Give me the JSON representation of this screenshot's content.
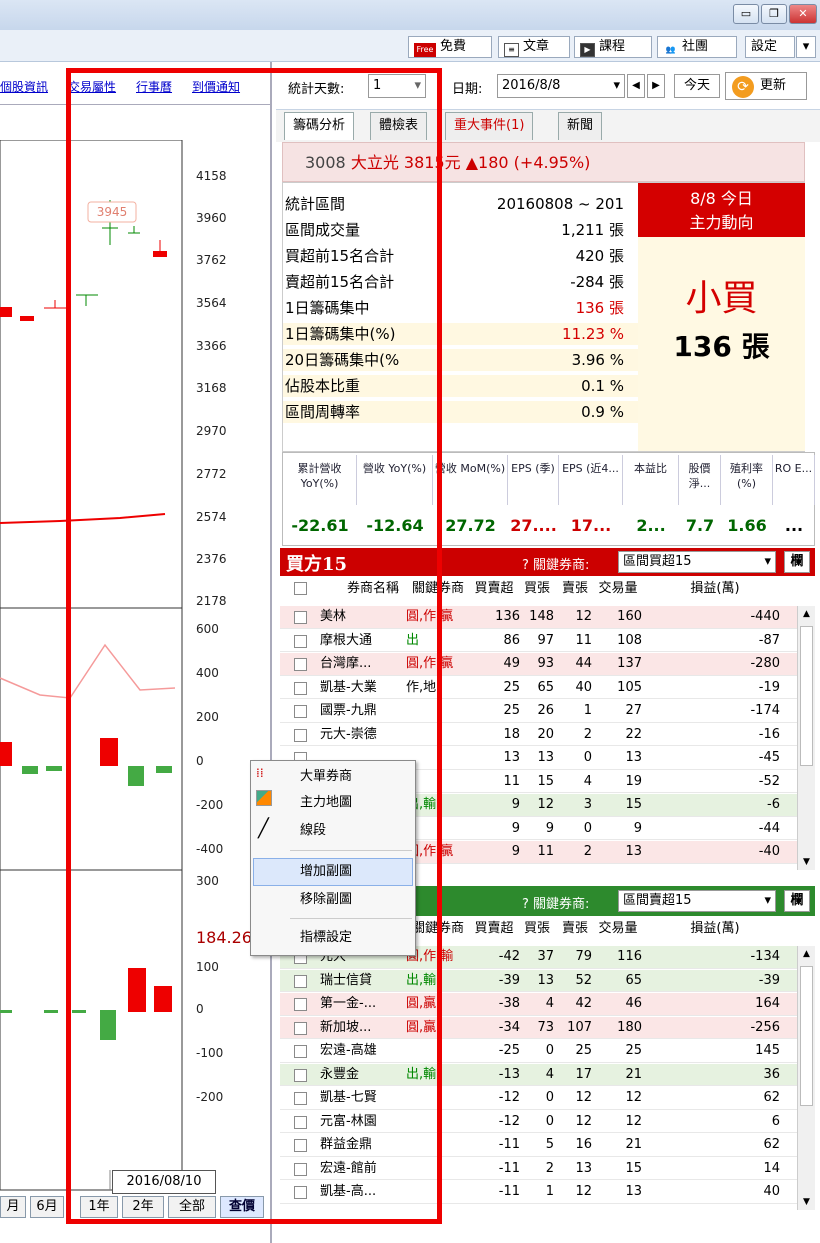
{
  "toolbar": {
    "free_badge": "Free",
    "free": "免費",
    "article": "文章",
    "course": "課程",
    "community": "社團",
    "settings": "設定"
  },
  "left_links": [
    "個股資訊",
    "交易屬性",
    "行事曆",
    "到價通知"
  ],
  "chart": {
    "price_axis": [
      "4158",
      "3960",
      "3762",
      "3564",
      "3366",
      "3168",
      "2970",
      "2772",
      "2574",
      "2376",
      "2178"
    ],
    "mid_axis": [
      "600",
      "400",
      "200",
      "0",
      "-200",
      "-400"
    ],
    "low_axis": [
      "300",
      "184.26",
      "100",
      "0",
      "-100",
      "-200"
    ],
    "peak_label": "3945",
    "date_label": "2016/08/10",
    "periods": [
      "月",
      "6月",
      "1年",
      "2年",
      "全部",
      "查價"
    ]
  },
  "stat_bar": {
    "days_label": "統計天數:",
    "days_value": "1",
    "date_label": "日期:",
    "date_value": "2016/8/8",
    "today": "今天",
    "refresh": "更新"
  },
  "tabs": [
    "籌碼分析",
    "體檢表",
    "重大事件(1)",
    "新聞"
  ],
  "stock": {
    "code": "3008",
    "name": "大立光",
    "price": "3815元",
    "change": "▲180 (+4.95%)"
  },
  "stats": [
    {
      "k": "統計區間",
      "v": "20160808 ~ 201"
    },
    {
      "k": "區間成交量",
      "v": "1,211 張"
    },
    {
      "k": "買超前15名合計",
      "v": "420 張"
    },
    {
      "k": "賣超前15名合計",
      "v": "-284 張"
    },
    {
      "k": "1日籌碼集中",
      "v": "136 張"
    },
    {
      "k": "1日籌碼集中(%)",
      "v": "11.23 %"
    },
    {
      "k": "20日籌碼集中(%",
      "v": "3.96 %"
    },
    {
      "k": "佔股本比重",
      "v": "0.1 %"
    },
    {
      "k": "區間周轉率",
      "v": "0.9 %"
    }
  ],
  "today_box": {
    "title": "8/8 今日",
    "subtitle": "主力動向",
    "action": "小買",
    "amount": "136 張"
  },
  "metrics": [
    {
      "h": "累計營收 YoY(%)",
      "v": "-22.61"
    },
    {
      "h": "營收 YoY(%)",
      "v": "-12.64"
    },
    {
      "h": "營收 MoM(%)",
      "v": "27.72"
    },
    {
      "h": "EPS (季)",
      "v": "27...."
    },
    {
      "h": "EPS (近4...",
      "v": "17..."
    },
    {
      "h": "本益比",
      "v": "2..."
    },
    {
      "h": "股價淨...",
      "v": "7.7"
    },
    {
      "h": "殖利率(%)",
      "v": "1.66"
    },
    {
      "h": "RO E...",
      "v": "..."
    }
  ],
  "buy_table": {
    "title": "買方15",
    "key_label": "? 關鍵券商:",
    "select": "區間買超15",
    "btn": "欄",
    "headers": [
      "券商名稱",
      "關鍵券商",
      "買賣超",
      "買張",
      "賣張",
      "交易量",
      "損益(萬)"
    ],
    "rows": [
      {
        "name": "美林",
        "tag": "圓,作,贏",
        "net": "136",
        "buy": "148",
        "sell": "12",
        "vol": "160",
        "pl": "-440"
      },
      {
        "name": "摩根大通",
        "tag": "出",
        "net": "86",
        "buy": "97",
        "sell": "11",
        "vol": "108",
        "pl": "-87"
      },
      {
        "name": "台灣摩...",
        "tag": "圓,作,贏",
        "net": "49",
        "buy": "93",
        "sell": "44",
        "vol": "137",
        "pl": "-280"
      },
      {
        "name": "凱基-大業",
        "tag": "作,地",
        "net": "25",
        "buy": "65",
        "sell": "40",
        "vol": "105",
        "pl": "-19"
      },
      {
        "name": "國票-九鼎",
        "tag": "",
        "net": "25",
        "buy": "26",
        "sell": "1",
        "vol": "27",
        "pl": "-174"
      },
      {
        "name": "元大-崇德",
        "tag": "",
        "net": "18",
        "buy": "20",
        "sell": "2",
        "vol": "22",
        "pl": "-16"
      },
      {
        "name": "",
        "tag": "",
        "net": "13",
        "buy": "13",
        "sell": "0",
        "vol": "13",
        "pl": "-45"
      },
      {
        "name": "",
        "tag": "",
        "net": "11",
        "buy": "15",
        "sell": "4",
        "vol": "19",
        "pl": "-52"
      },
      {
        "name": "",
        "tag": "出,輸",
        "net": "9",
        "buy": "12",
        "sell": "3",
        "vol": "15",
        "pl": "-6"
      },
      {
        "name": "",
        "tag": "",
        "net": "9",
        "buy": "9",
        "sell": "0",
        "vol": "9",
        "pl": "-44"
      },
      {
        "name": "",
        "tag": "圓,作,贏",
        "net": "9",
        "buy": "11",
        "sell": "2",
        "vol": "13",
        "pl": "-40"
      }
    ]
  },
  "sell_table": {
    "key_label": "? 關鍵券商:",
    "select": "區間賣超15",
    "btn": "欄",
    "headers": [
      "關鍵券商",
      "買賣超",
      "買張",
      "賣張",
      "交易量",
      "損益(萬)"
    ],
    "rows": [
      {
        "name": "元大",
        "tag": "圓,作,輸",
        "net": "-42",
        "buy": "37",
        "sell": "79",
        "vol": "116",
        "pl": "-134"
      },
      {
        "name": "瑞士信貸",
        "tag": "出,輸",
        "net": "-39",
        "buy": "13",
        "sell": "52",
        "vol": "65",
        "pl": "-39"
      },
      {
        "name": "第一金-...",
        "tag": "圓,贏",
        "net": "-38",
        "buy": "4",
        "sell": "42",
        "vol": "46",
        "pl": "164"
      },
      {
        "name": "新加坡...",
        "tag": "圓,贏",
        "net": "-34",
        "buy": "73",
        "sell": "107",
        "vol": "180",
        "pl": "-256"
      },
      {
        "name": "宏遠-高雄",
        "tag": "",
        "net": "-25",
        "buy": "0",
        "sell": "25",
        "vol": "25",
        "pl": "145"
      },
      {
        "name": "永豐金",
        "tag": "出,輸",
        "net": "-13",
        "buy": "4",
        "sell": "17",
        "vol": "21",
        "pl": "36"
      },
      {
        "name": "凱基-七賢",
        "tag": "",
        "net": "-12",
        "buy": "0",
        "sell": "12",
        "vol": "12",
        "pl": "62"
      },
      {
        "name": "元富-林園",
        "tag": "",
        "net": "-12",
        "buy": "0",
        "sell": "12",
        "vol": "12",
        "pl": "6"
      },
      {
        "name": "群益金鼎",
        "tag": "",
        "net": "-11",
        "buy": "5",
        "sell": "16",
        "vol": "21",
        "pl": "62"
      },
      {
        "name": "宏遠-館前",
        "tag": "",
        "net": "-11",
        "buy": "2",
        "sell": "13",
        "vol": "15",
        "pl": "14"
      },
      {
        "name": "凱基-高...",
        "tag": "",
        "net": "-11",
        "buy": "1",
        "sell": "12",
        "vol": "13",
        "pl": "40"
      }
    ]
  },
  "context_menu": [
    "大單券商",
    "主力地圖",
    "線段",
    "增加副圖",
    "移除副圖",
    "指標設定"
  ]
}
